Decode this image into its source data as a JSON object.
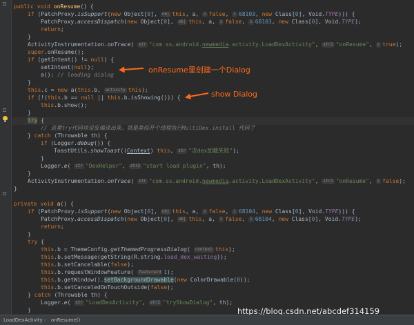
{
  "code_lines": [
    [
      [
        "kw",
        "public void "
      ],
      [
        "fn",
        "onResume"
      ],
      [
        "",
        "() {"
      ]
    ],
    [
      [
        "kw",
        "if "
      ],
      [
        "",
        "(PatchProxy."
      ],
      [
        "it",
        "isSupport"
      ],
      [
        "",
        "("
      ],
      [
        "kw",
        "new "
      ],
      [
        "",
        "Object["
      ],
      [
        "nu",
        "0"
      ],
      [
        "",
        "], "
      ],
      [
        "hint",
        "obj"
      ],
      [
        "kw",
        "this"
      ],
      [
        "",
        ", a, "
      ],
      [
        "hint",
        "z"
      ],
      [
        "kw",
        "false"
      ],
      [
        "",
        ", "
      ],
      [
        "hint",
        "i"
      ],
      [
        "nu",
        "68103"
      ],
      [
        "",
        ", "
      ],
      [
        "kw",
        "new "
      ],
      [
        "",
        "Class["
      ],
      [
        "nu",
        "0"
      ],
      [
        "",
        "], Void."
      ],
      [
        "fd it",
        "TYPE"
      ],
      [
        "",
        "))) {"
      ]
    ],
    [
      [
        "",
        "PatchProxy."
      ],
      [
        "it",
        "accessDispatch"
      ],
      [
        "",
        "("
      ],
      [
        "kw",
        "new "
      ],
      [
        "",
        "Object["
      ],
      [
        "nu",
        "0"
      ],
      [
        "",
        "], "
      ],
      [
        "hint",
        "obj"
      ],
      [
        "kw",
        "this"
      ],
      [
        "",
        ", a, "
      ],
      [
        "hint",
        "z"
      ],
      [
        "kw",
        "false"
      ],
      [
        "",
        ", "
      ],
      [
        "hint",
        "i"
      ],
      [
        "nu",
        "68103"
      ],
      [
        "",
        ", "
      ],
      [
        "kw",
        "new "
      ],
      [
        "",
        "Class["
      ],
      [
        "nu",
        "0"
      ],
      [
        "",
        "], Void."
      ],
      [
        "fd it",
        "TYPE"
      ],
      [
        "",
        ");"
      ]
    ],
    [
      [
        "kw",
        "return"
      ],
      [
        "",
        ";"
      ]
    ],
    [
      [
        "",
        "}"
      ]
    ],
    [
      [
        "",
        "ActivityInstrumentation."
      ],
      [
        "it",
        "onTrace"
      ],
      [
        "",
        "( "
      ],
      [
        "hint",
        "str"
      ],
      [
        "st",
        "\"com.ss.android."
      ],
      [
        "st uline",
        "newmedia"
      ],
      [
        "st",
        ".activity.LoadDexActivity\""
      ],
      [
        "",
        ", "
      ],
      [
        "hint",
        "str2"
      ],
      [
        "st",
        "\"onResume\""
      ],
      [
        "",
        ", "
      ],
      [
        "hint",
        "z"
      ],
      [
        "kw",
        "true"
      ],
      [
        "",
        ");"
      ]
    ],
    [
      [
        "kw",
        "super"
      ],
      [
        "",
        ".onResume();"
      ]
    ],
    [
      [
        "kw",
        "if "
      ],
      [
        "",
        "(getIntent() != "
      ],
      [
        "kw",
        "null"
      ],
      [
        "",
        ") {"
      ]
    ],
    [
      [
        "",
        "setIntent("
      ],
      [
        "kw",
        "null"
      ],
      [
        "",
        ");"
      ]
    ],
    [
      [
        "",
        "a(); "
      ],
      [
        "cm",
        "// loading dialog"
      ]
    ],
    [
      [
        "",
        "}"
      ]
    ],
    [
      [
        "kw",
        "this"
      ],
      [
        "",
        ".c = "
      ],
      [
        "kw",
        "new "
      ],
      [
        "",
        "a("
      ],
      [
        "kw",
        "this"
      ],
      [
        "",
        ".b, "
      ],
      [
        "hint",
        "activity"
      ],
      [
        "kw",
        "this"
      ],
      [
        "",
        ");"
      ]
    ],
    [
      [
        "kw",
        "if "
      ],
      [
        "",
        "(!("
      ],
      [
        "kw",
        "this"
      ],
      [
        "",
        ".b == "
      ],
      [
        "kw",
        "null "
      ],
      [
        "",
        "|| "
      ],
      [
        "kw",
        "this"
      ],
      [
        "",
        ".b.isShowing())) {"
      ]
    ],
    [
      [
        "kw",
        "this"
      ],
      [
        "",
        ".b.show();"
      ]
    ],
    [
      [
        "",
        "}"
      ]
    ],
    [
      [
        "kw tryhl",
        "try"
      ],
      [
        "",
        " {"
      ]
    ],
    [
      [
        "cm",
        "// 这里try代码块没反编译出来，就是类似开个线程执行MultiDex.install 代码了"
      ]
    ],
    [
      [
        "",
        "} "
      ],
      [
        "kw",
        "catch "
      ],
      [
        "",
        "(Throwable th) {"
      ]
    ],
    [
      [
        "kw",
        "if "
      ],
      [
        "",
        "(Logger."
      ],
      [
        "it",
        "debug"
      ],
      [
        "",
        "()) {"
      ]
    ],
    [
      [
        "",
        "ToastUtils."
      ],
      [
        "it",
        "showToast"
      ],
      [
        "",
        "(("
      ],
      [
        "uline",
        "Context"
      ],
      [
        "",
        ") "
      ],
      [
        "kw",
        "this"
      ],
      [
        "",
        ", "
      ],
      [
        "hint",
        "str"
      ],
      [
        "st",
        "\"次dex加载失败\""
      ],
      [
        "",
        ");"
      ]
    ],
    [
      [
        "",
        "}"
      ]
    ],
    [
      [
        "",
        "Logger."
      ],
      [
        "it",
        "e"
      ],
      [
        "",
        "( "
      ],
      [
        "hint",
        "str"
      ],
      [
        "st",
        "\"DexHelper\""
      ],
      [
        "",
        ", "
      ],
      [
        "hint",
        "str2"
      ],
      [
        "st",
        "\"start load plugin\""
      ],
      [
        "",
        ", th);"
      ]
    ],
    [
      [
        "",
        "}"
      ]
    ],
    [
      [
        "",
        "ActivityInstrumentation."
      ],
      [
        "it",
        "onTrace"
      ],
      [
        "",
        "( "
      ],
      [
        "hint",
        "str"
      ],
      [
        "st",
        "\"com.ss.android."
      ],
      [
        "st uline",
        "newmedia"
      ],
      [
        "st",
        ".activity.LoadDexActivity\""
      ],
      [
        "",
        ", "
      ],
      [
        "hint",
        "str2"
      ],
      [
        "st",
        "\"onResume\""
      ],
      [
        "",
        ", "
      ],
      [
        "hint",
        "z"
      ],
      [
        "kw",
        "false"
      ],
      [
        "",
        ");"
      ]
    ],
    [
      [
        "",
        "}"
      ]
    ],
    [],
    [
      [
        "kw",
        "private void "
      ],
      [
        "fn",
        "a"
      ],
      [
        "",
        "() {"
      ]
    ],
    [
      [
        "kw",
        "if "
      ],
      [
        "",
        "(PatchProxy."
      ],
      [
        "it",
        "isSupport"
      ],
      [
        "",
        "("
      ],
      [
        "kw",
        "new "
      ],
      [
        "",
        "Object["
      ],
      [
        "nu",
        "0"
      ],
      [
        "",
        "], "
      ],
      [
        "hint",
        "obj"
      ],
      [
        "kw",
        "this"
      ],
      [
        "",
        ", a, "
      ],
      [
        "hint",
        "z"
      ],
      [
        "kw",
        "false"
      ],
      [
        "",
        ", "
      ],
      [
        "hint",
        "i"
      ],
      [
        "nu",
        "68104"
      ],
      [
        "",
        ", "
      ],
      [
        "kw",
        "new "
      ],
      [
        "",
        "Class["
      ],
      [
        "nu",
        "0"
      ],
      [
        "",
        "], Void."
      ],
      [
        "fd it",
        "TYPE"
      ],
      [
        "",
        "))) {"
      ]
    ],
    [
      [
        "",
        "PatchProxy."
      ],
      [
        "it",
        "accessDispatch"
      ],
      [
        "",
        "("
      ],
      [
        "kw",
        "new "
      ],
      [
        "",
        "Object["
      ],
      [
        "nu",
        "0"
      ],
      [
        "",
        "], "
      ],
      [
        "hint",
        "obj"
      ],
      [
        "kw",
        "this"
      ],
      [
        "",
        ", a, "
      ],
      [
        "hint",
        "z"
      ],
      [
        "kw",
        "false"
      ],
      [
        "",
        ", "
      ],
      [
        "hint",
        "i"
      ],
      [
        "nu",
        "68104"
      ],
      [
        "",
        ", "
      ],
      [
        "kw",
        "new "
      ],
      [
        "",
        "Class["
      ],
      [
        "nu",
        "0"
      ],
      [
        "",
        "], Void."
      ],
      [
        "fd it",
        "TYPE"
      ],
      [
        "",
        ");"
      ]
    ],
    [
      [
        "kw",
        "return"
      ],
      [
        "",
        ";"
      ]
    ],
    [
      [
        "",
        "}"
      ]
    ],
    [
      [
        "kw",
        "try "
      ],
      [
        "",
        "{"
      ]
    ],
    [
      [
        "kw",
        "this"
      ],
      [
        "",
        ".b = ThemeConfig."
      ],
      [
        "it",
        "getThemedProgressDialog"
      ],
      [
        "",
        "( "
      ],
      [
        "hint",
        "context"
      ],
      [
        "kw",
        "this"
      ],
      [
        "",
        ");"
      ]
    ],
    [
      [
        "kw",
        "this"
      ],
      [
        "",
        ".b.setMessage(getString(R.string."
      ],
      [
        "fd",
        "load_dex_waiting"
      ],
      [
        "",
        "));"
      ]
    ],
    [
      [
        "kw",
        "this"
      ],
      [
        "",
        ".b.setCancelable("
      ],
      [
        "kw",
        "false"
      ],
      [
        "",
        ");"
      ]
    ],
    [
      [
        "kw",
        "this"
      ],
      [
        "",
        ".b.requestWindowFeature( "
      ],
      [
        "hint",
        "featureId"
      ],
      [
        "nu",
        "1"
      ],
      [
        "",
        ");"
      ]
    ],
    [
      [
        "kw",
        "this"
      ],
      [
        "",
        ".b.getWindow()."
      ],
      [
        "tryhl",
        "setBackgroundDrawable"
      ],
      [
        "",
        "("
      ],
      [
        "kw",
        "new "
      ],
      [
        "",
        "ColorDrawable("
      ],
      [
        "nu",
        "0"
      ],
      [
        "",
        "));"
      ]
    ],
    [
      [
        "kw",
        "this"
      ],
      [
        "",
        ".b.setCanceledOnTouchOutside("
      ],
      [
        "kw",
        "false"
      ],
      [
        "",
        ");"
      ]
    ],
    [
      [
        "",
        "} "
      ],
      [
        "kw",
        "catch "
      ],
      [
        "",
        "(Throwable th) {"
      ]
    ],
    [
      [
        "",
        "Logger."
      ],
      [
        "it",
        "e"
      ],
      [
        "",
        "( "
      ],
      [
        "hint",
        "str"
      ],
      [
        "st",
        "\"LoadDexActivity\""
      ],
      [
        "",
        ", "
      ],
      [
        "hint",
        "str2"
      ],
      [
        "st",
        "\"tryShowDialog\""
      ],
      [
        "",
        ", th);"
      ]
    ],
    [
      [
        "",
        "}"
      ]
    ],
    [
      [
        "",
        "}"
      ]
    ],
    [
      [
        "",
        "}"
      ]
    ]
  ],
  "annotations": {
    "dialog_create": "onResume里创建一个Dialog",
    "dialog_show": "show Dialog"
  },
  "breadcrumb": {
    "class_name": "LoadDexActivity",
    "separator": "›",
    "method_name": "onResume()"
  },
  "watermark": "https://blog.csdn.net/abcdef314159",
  "colors": {
    "annotation": "#ff6a1a",
    "background": "#2b2b2b"
  }
}
